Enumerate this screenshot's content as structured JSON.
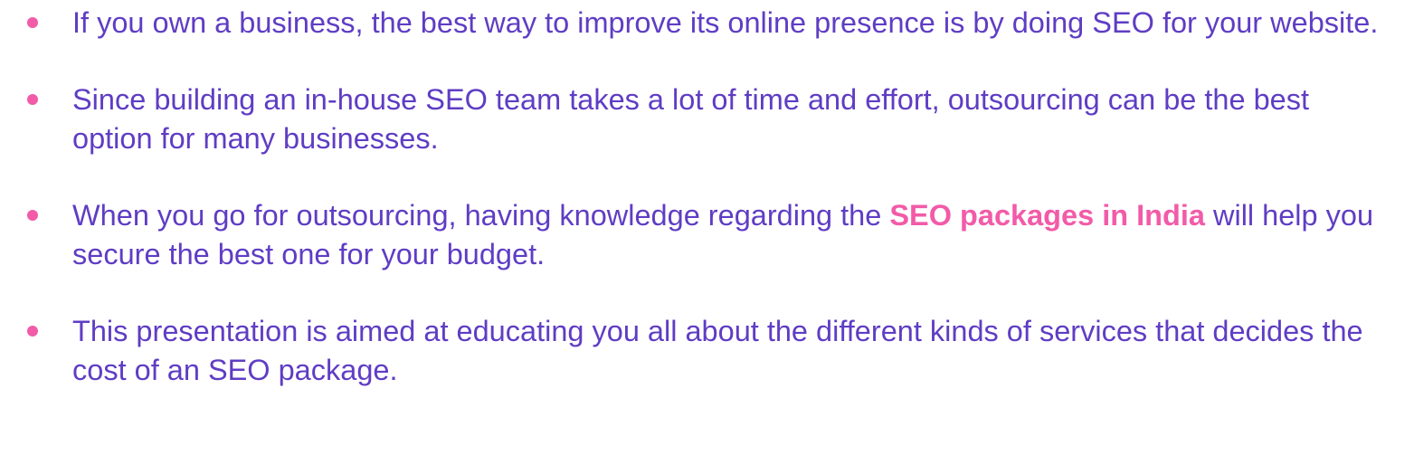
{
  "bullets": [
    {
      "text": "If you own a business, the best way to improve its online presence is by doing SEO for your website."
    },
    {
      "text": "Since building an in-house SEO team takes a lot of time and effort, outsourcing can be the best option for many businesses."
    },
    {
      "text_before": "When you go for outsourcing, having knowledge regarding the ",
      "highlight": "SEO packages in India",
      "text_after": " will help you secure the best one for your budget."
    },
    {
      "text": "This presentation is aimed at educating you all about the different kinds of services that decides the cost of an SEO package."
    }
  ],
  "colors": {
    "text": "#5f3dc4",
    "accent": "#f25ba8"
  }
}
